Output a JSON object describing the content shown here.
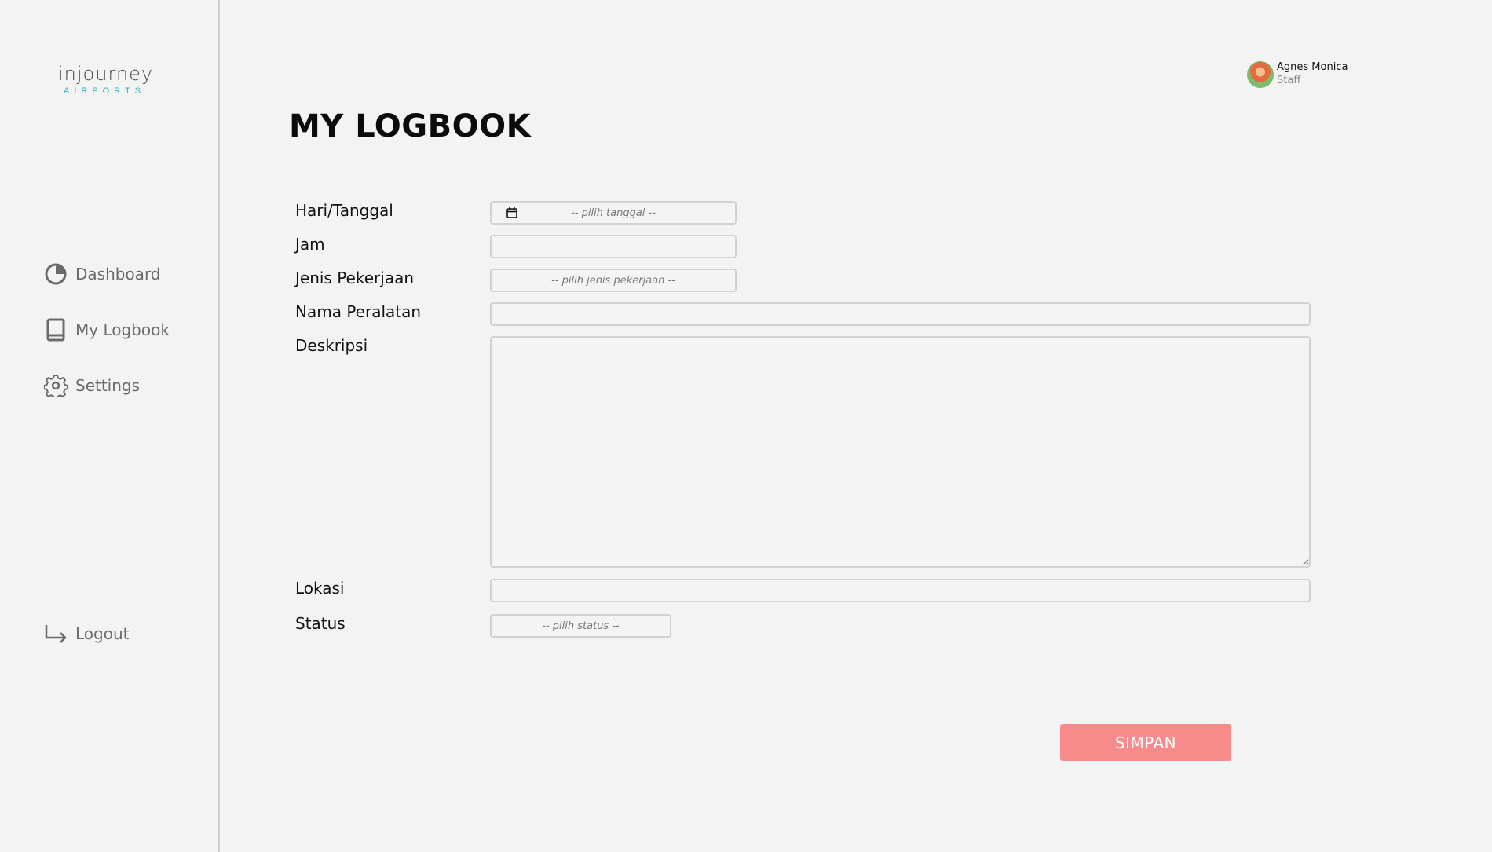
{
  "brand": {
    "name": "injourney",
    "sub": "AIRPORTS"
  },
  "sidebar": {
    "items": [
      {
        "label": "Dashboard",
        "icon": "pie-chart-icon"
      },
      {
        "label": "My Logbook",
        "icon": "book-icon"
      },
      {
        "label": "Settings",
        "icon": "gear-icon"
      }
    ],
    "logout": {
      "label": "Logout",
      "icon": "logout-arrow-icon"
    }
  },
  "user": {
    "name": "Agnes Monica",
    "role": "Staff"
  },
  "page": {
    "title": "MY LOGBOOK"
  },
  "form": {
    "date": {
      "label": "Hari/Tanggal",
      "placeholder": "-- pilih tanggal --"
    },
    "time": {
      "label": "Jam",
      "value": ""
    },
    "work_type": {
      "label": "Jenis Pekerjaan",
      "placeholder": "-- pilih jenis pekerjaan --"
    },
    "equipment": {
      "label": "Nama Peralatan",
      "value": ""
    },
    "description": {
      "label": "Deskripsi",
      "value": ""
    },
    "location": {
      "label": "Lokasi",
      "value": ""
    },
    "status": {
      "label": "Status",
      "placeholder": "-- pilih status --"
    },
    "submit_label": "SIMPAN"
  },
  "colors": {
    "accent": "#f78b8b",
    "brand_sub": "#2bb3c8",
    "background": "#f3f3f3"
  }
}
